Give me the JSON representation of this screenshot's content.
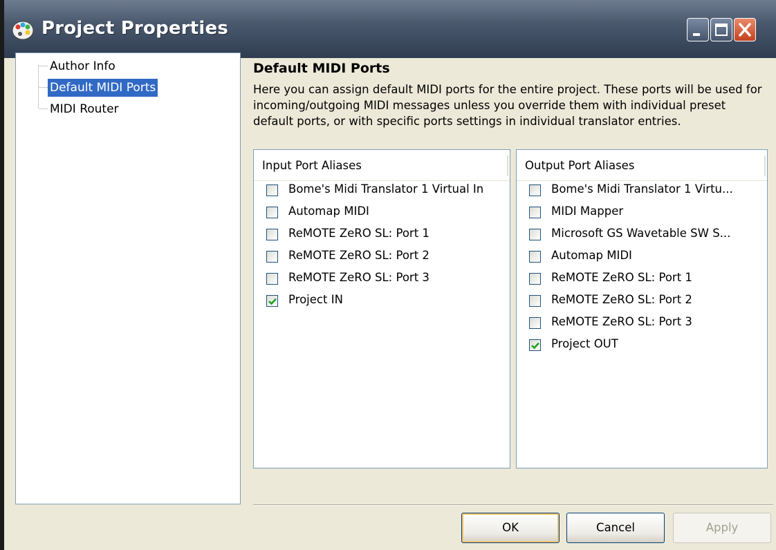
{
  "window": {
    "title": "Project Properties"
  },
  "tree": {
    "items": [
      {
        "label": "Author Info",
        "selected": false
      },
      {
        "label": "Default MIDI Ports",
        "selected": true
      },
      {
        "label": "MIDI Router",
        "selected": false
      }
    ]
  },
  "main": {
    "heading": "Default MIDI Ports",
    "description": "Here you can assign default MIDI ports for the entire project. These ports will be used for incoming/outgoing MIDI messages unless you override them with individual preset default ports, or with specific ports settings in individual translator entries."
  },
  "input_ports": {
    "header": "Input Port Aliases",
    "items": [
      {
        "label": "Bome's Midi Translator 1 Virtual In",
        "checked": false
      },
      {
        "label": "Automap MIDI",
        "checked": false
      },
      {
        "label": "ReMOTE ZeRO SL: Port 1",
        "checked": false
      },
      {
        "label": "ReMOTE ZeRO SL: Port 2",
        "checked": false
      },
      {
        "label": "ReMOTE ZeRO SL: Port 3",
        "checked": false
      },
      {
        "label": "Project IN",
        "checked": true
      }
    ]
  },
  "output_ports": {
    "header": "Output Port Aliases",
    "items": [
      {
        "label": "Bome's Midi Translator 1 Virtu...",
        "checked": false
      },
      {
        "label": "MIDI Mapper",
        "checked": false
      },
      {
        "label": "Microsoft GS Wavetable SW S...",
        "checked": false
      },
      {
        "label": "Automap MIDI",
        "checked": false
      },
      {
        "label": "ReMOTE ZeRO SL: Port 1",
        "checked": false
      },
      {
        "label": "ReMOTE ZeRO SL: Port 2",
        "checked": false
      },
      {
        "label": "ReMOTE ZeRO SL: Port 3",
        "checked": false
      },
      {
        "label": "Project OUT",
        "checked": true
      }
    ]
  },
  "buttons": {
    "ok": "OK",
    "cancel": "Cancel",
    "apply": "Apply"
  },
  "colors": {
    "selection": "#316ac5",
    "checkmark": "#21a121"
  }
}
